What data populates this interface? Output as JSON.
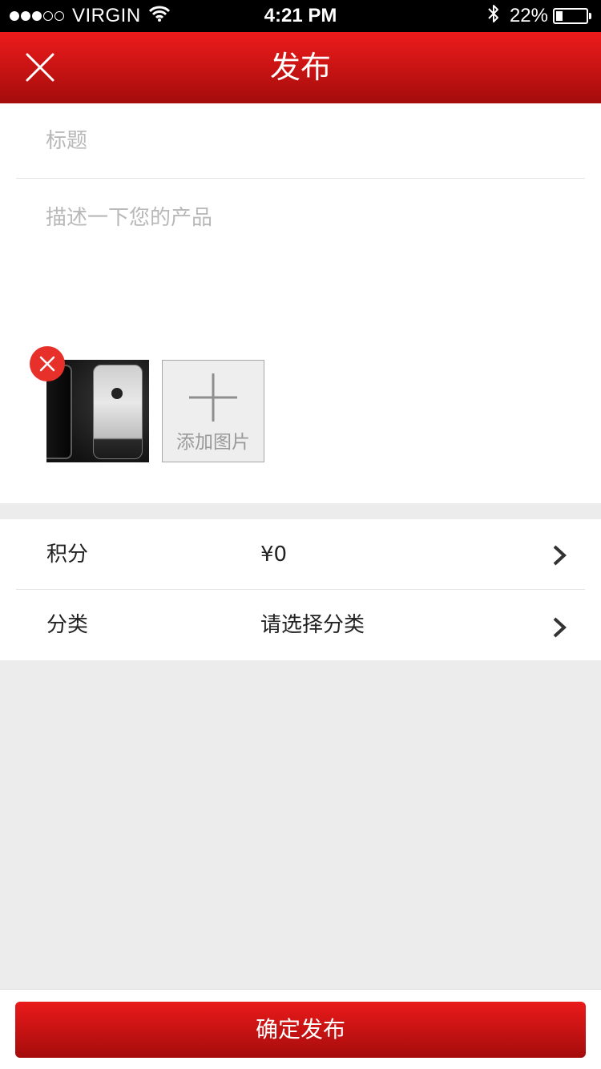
{
  "status_bar": {
    "carrier": "VIRGIN",
    "time": "4:21 PM",
    "battery_percent": "22%",
    "signal_bars": 3,
    "signal_total": 5,
    "battery_level": 0.22,
    "icons": [
      "wifi-icon",
      "bluetooth-icon",
      "battery-icon"
    ]
  },
  "nav": {
    "title": "发布",
    "close_icon": "close-icon",
    "background": "#d81414"
  },
  "form": {
    "title_placeholder": "标题",
    "title_value": "",
    "description_placeholder": "描述一下您的产品",
    "description_value": "",
    "photo_remove_icon": "close-icon",
    "add_photo_label": "添加图片",
    "add_photo_icon": "plus-icon"
  },
  "options": [
    {
      "label": "积分",
      "value": "¥0",
      "icon": "chevron-right-icon"
    },
    {
      "label": "分类",
      "value": "请选择分类",
      "icon": "chevron-right-icon"
    }
  ],
  "submit": {
    "label": "确定发布"
  },
  "colors": {
    "accent": "#d81414",
    "remove_badge": "#e8302a",
    "page_background": "#ececec"
  }
}
